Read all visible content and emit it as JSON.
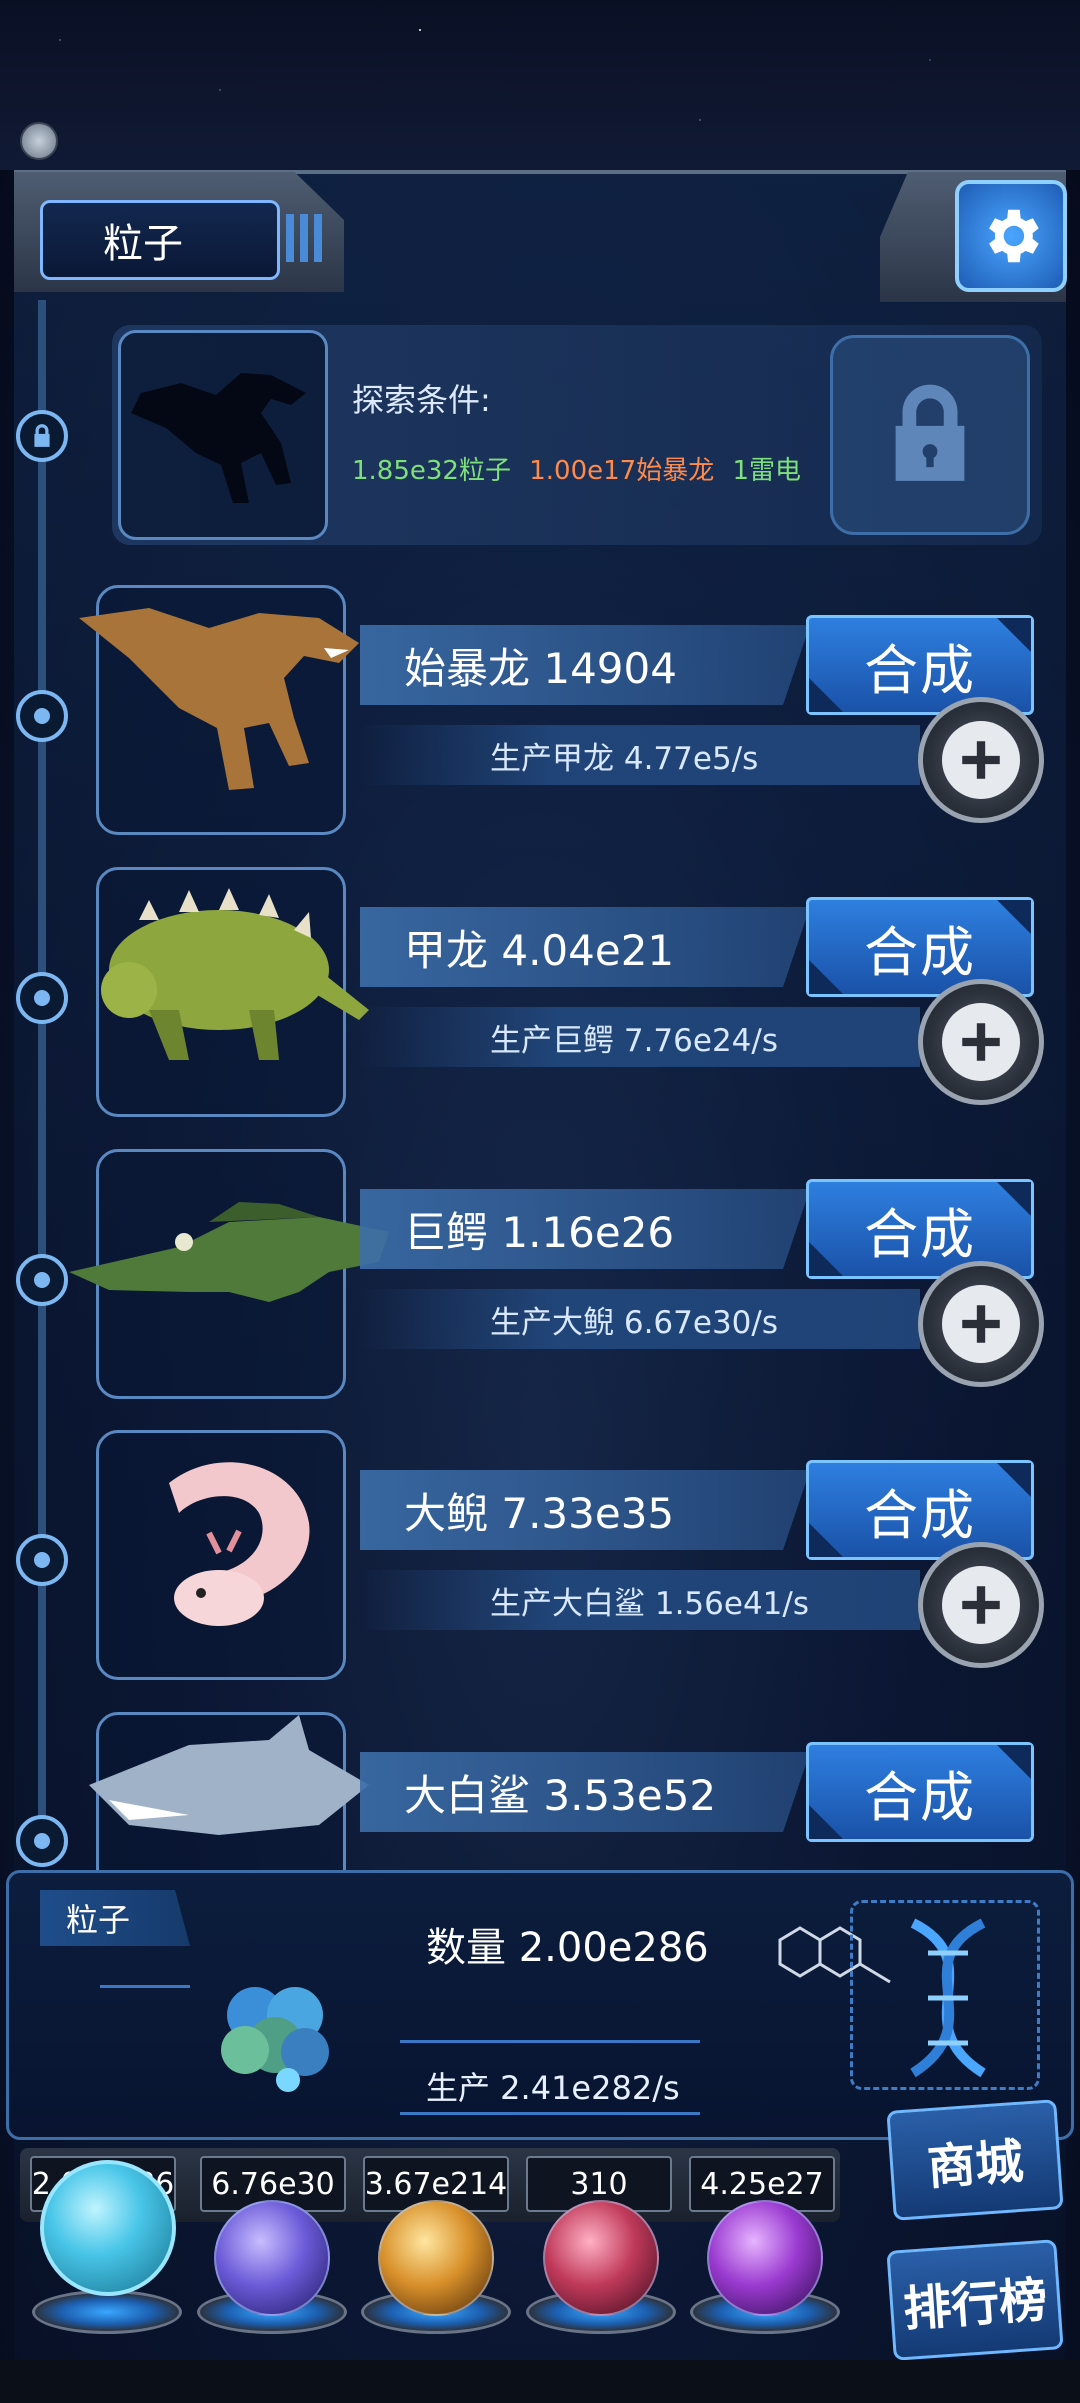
{
  "header": {
    "title": "粒子"
  },
  "explore": {
    "label": "探索条件:",
    "requirements": [
      {
        "text": "1.85e32粒子",
        "color": "#7ee07a"
      },
      {
        "text": "1.00e17始暴龙",
        "color": "#ff8a4a"
      },
      {
        "text": "1雷电",
        "color": "#7ee07a"
      }
    ]
  },
  "creatures": [
    {
      "name": "始暴龙 14904",
      "production": "生产甲龙 4.77e5/s",
      "craft_label": "合成",
      "icon": "t-rex-icon",
      "color": "#a8743a"
    },
    {
      "name": "甲龙 4.04e21",
      "production": "生产巨鳄 7.76e24/s",
      "craft_label": "合成",
      "icon": "ankylosaurus-icon",
      "color": "#8ea63e"
    },
    {
      "name": "巨鳄 1.16e26",
      "production": "生产大鲵 6.67e30/s",
      "craft_label": "合成",
      "icon": "crocodile-icon",
      "color": "#4f7a3a"
    },
    {
      "name": "大鲵 7.33e35",
      "production": "生产大白鲨 1.56e41/s",
      "craft_label": "合成",
      "icon": "axolotl-icon",
      "color": "#f2c8cc"
    },
    {
      "name": "大白鲨 3.53e52",
      "production": "",
      "craft_label": "合成",
      "icon": "shark-icon",
      "color": "#9fb2c8"
    }
  ],
  "particle_panel": {
    "tag": "粒子",
    "quantity": "数量 2.00e286",
    "production": "生产 2.41e282/s"
  },
  "resources": [
    {
      "value": "2.00e286",
      "icon": "particle-orb-icon",
      "color": "#49c6e8"
    },
    {
      "value": "6.76e30",
      "icon": "lightning-orb-icon",
      "color": "#6b5bd8"
    },
    {
      "value": "3.67e214",
      "icon": "fire-orb-icon",
      "color": "#d8902a"
    },
    {
      "value": "310",
      "icon": "brain-orb-icon",
      "color": "#c03a5a"
    },
    {
      "value": "4.25e27",
      "icon": "vortex-orb-icon",
      "color": "#9a3ad0"
    }
  ],
  "side_buttons": {
    "shop": "商城",
    "leaderboard": "排行榜"
  }
}
